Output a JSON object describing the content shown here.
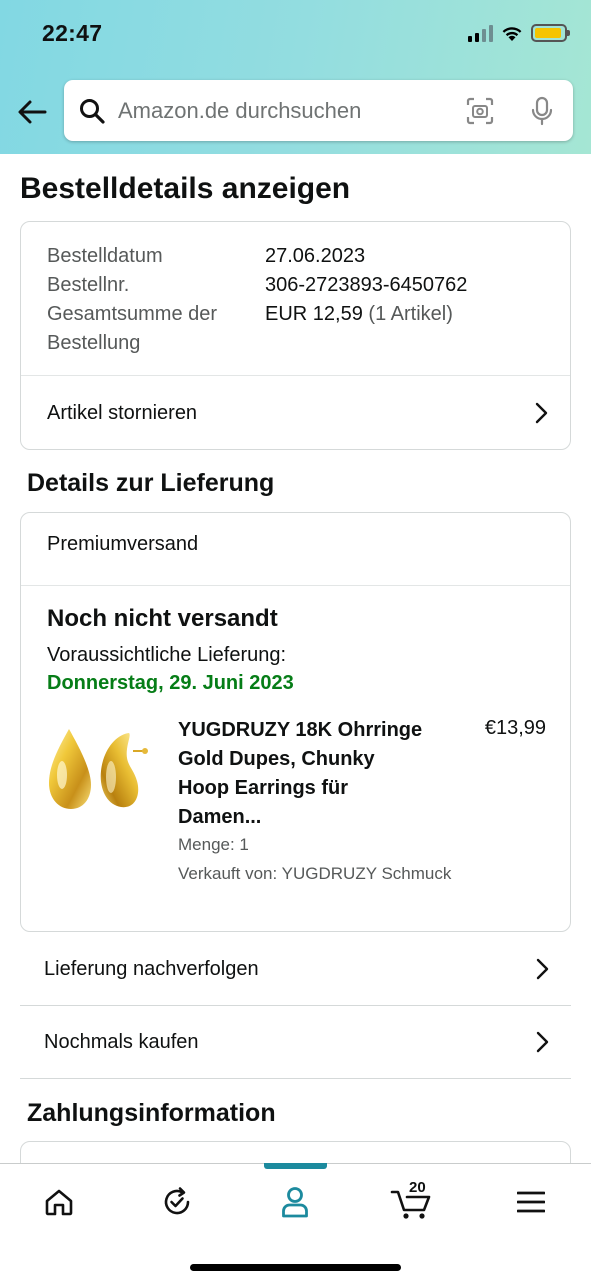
{
  "status_bar": {
    "time": "22:47"
  },
  "search": {
    "placeholder": "Amazon.de durchsuchen"
  },
  "page": {
    "title": "Bestelldetails anzeigen"
  },
  "order_summary": {
    "rows": [
      {
        "label": "Bestelldatum",
        "value": "27.06.2023"
      },
      {
        "label": "Bestellnr.",
        "value": "306-2723893-6450762"
      },
      {
        "label": "Gesamtsumme der Bestellung",
        "value": "EUR 12,59",
        "extra": "(1 Artikel)"
      }
    ],
    "cancel_label": "Artikel stornieren"
  },
  "delivery": {
    "section_title": "Details zur Lieferung",
    "shipping_method": "Premiumversand",
    "status": "Noch nicht versandt",
    "eta_label": "Voraussichtliche Lieferung:",
    "eta_date": "Donnerstag, 29. Juni 2023",
    "product": {
      "title": "YUGDRUZY 18K Ohrringe Gold Dupes, Chunky Hoop Earrings für Damen...",
      "price": "€13,99",
      "quantity": "Menge: 1",
      "seller": "Verkauft von: YUGDRUZY Schmuck"
    }
  },
  "actions": {
    "track": "Lieferung nachverfolgen",
    "buy_again": "Nochmals kaufen"
  },
  "payment": {
    "section_title": "Zahlungsinformation"
  },
  "bottom_nav": {
    "items": [
      "home-icon",
      "orders-refresh-icon",
      "account-icon",
      "cart-icon",
      "menu-icon"
    ],
    "active": "account-icon",
    "cart_count": "20",
    "accent_color": "#1c8a9e"
  },
  "colors": {
    "delivery_date": "#067d17",
    "header_gradient_start": "#82d8e3",
    "header_gradient_end": "#a5e6d4"
  }
}
